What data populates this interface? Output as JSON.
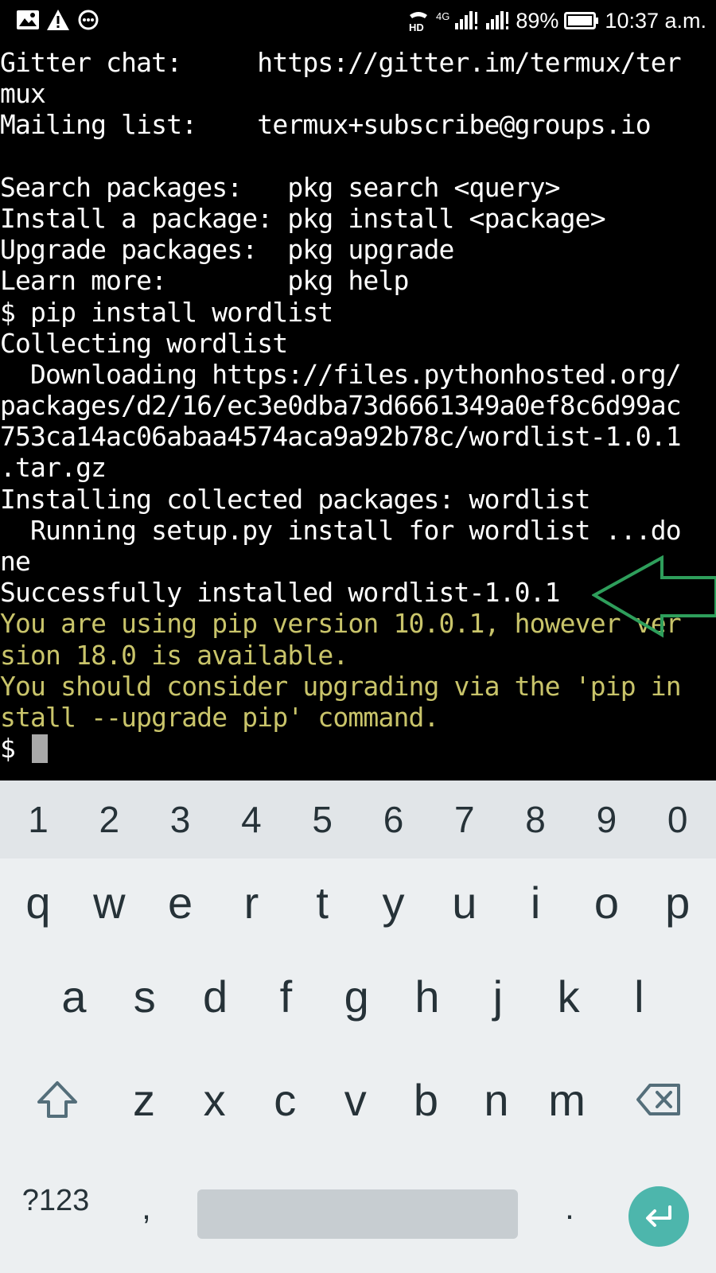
{
  "status_bar": {
    "battery_percent": "89%",
    "time": "10:37 a.m.",
    "network_label": "4G",
    "hd_label": "HD",
    "icons_left": [
      "image-icon",
      "warning-icon",
      "messaging-icon"
    ],
    "icons_right": [
      "hd-voice-icon",
      "signal-4g-icon",
      "signal-icon",
      "battery-icon"
    ]
  },
  "terminal": {
    "lines": [
      {
        "text": "Gitter chat:     https://gitter.im/termux/ter",
        "style": "normal"
      },
      {
        "text": "mux",
        "style": "normal"
      },
      {
        "text": "Mailing list:    termux+subscribe@groups.io",
        "style": "normal"
      },
      {
        "text": "",
        "style": "normal"
      },
      {
        "text": "Search packages:   pkg search <query>",
        "style": "normal"
      },
      {
        "text": "Install a package: pkg install <package>",
        "style": "normal"
      },
      {
        "text": "Upgrade packages:  pkg upgrade",
        "style": "normal"
      },
      {
        "text": "Learn more:        pkg help",
        "style": "normal"
      },
      {
        "text": "$ pip install wordlist",
        "style": "normal"
      },
      {
        "text": "Collecting wordlist",
        "style": "normal"
      },
      {
        "text": "  Downloading https://files.pythonhosted.org/",
        "style": "normal"
      },
      {
        "text": "packages/d2/16/ec3e0dba73d6661349a0ef8c6d99ac",
        "style": "normal"
      },
      {
        "text": "753ca14ac06abaa4574aca9a92b78c/wordlist-1.0.1",
        "style": "normal"
      },
      {
        "text": ".tar.gz",
        "style": "normal"
      },
      {
        "text": "Installing collected packages: wordlist",
        "style": "normal"
      },
      {
        "text": "  Running setup.py install for wordlist ...do",
        "style": "normal"
      },
      {
        "text": "ne",
        "style": "normal"
      },
      {
        "text": "Successfully installed wordlist-1.0.1",
        "style": "normal"
      },
      {
        "text": "You are using pip version 10.0.1, however ver",
        "style": "warn"
      },
      {
        "text": "sion 18.0 is available.",
        "style": "warn"
      },
      {
        "text": "You should consider upgrading via the 'pip in",
        "style": "warn"
      },
      {
        "text": "stall --upgrade pip' command.",
        "style": "warn"
      }
    ],
    "prompt": "$ ",
    "colors": {
      "text": "#ffffff",
      "warning": "#c9c46a",
      "background": "#000000",
      "annotation_arrow": "#2e9e5b"
    }
  },
  "keyboard": {
    "number_row": [
      "1",
      "2",
      "3",
      "4",
      "5",
      "6",
      "7",
      "8",
      "9",
      "0"
    ],
    "row1": [
      "q",
      "w",
      "e",
      "r",
      "t",
      "y",
      "u",
      "i",
      "o",
      "p"
    ],
    "row2": [
      "a",
      "s",
      "d",
      "f",
      "g",
      "h",
      "j",
      "k",
      "l"
    ],
    "row3": [
      "z",
      "x",
      "c",
      "v",
      "b",
      "n",
      "m"
    ],
    "symbols_label": "?123",
    "comma_label": ",",
    "period_label": ".",
    "enter_color": "#4db6ac"
  }
}
